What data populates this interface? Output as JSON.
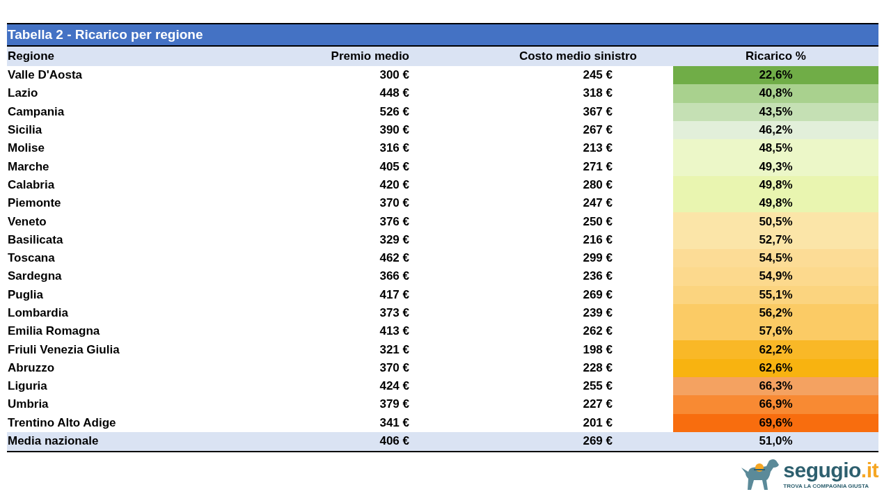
{
  "table": {
    "title": "Tabella 2 - Ricarico per regione",
    "columns": [
      "Regione",
      "Premio medio",
      "Costo medio sinistro",
      "Ricarico %"
    ],
    "rows": [
      {
        "region": "Valle D'Aosta",
        "premium": "300 €",
        "cost": "245 €",
        "markup": "22,6%",
        "color": "#70ad47"
      },
      {
        "region": "Lazio",
        "premium": "448 €",
        "cost": "318 €",
        "markup": "40,8%",
        "color": "#a9d18e"
      },
      {
        "region": "Campania",
        "premium": "526 €",
        "cost": "367 €",
        "markup": "43,5%",
        "color": "#c5e0b4"
      },
      {
        "region": "Sicilia",
        "premium": "390 €",
        "cost": "267 €",
        "markup": "46,2%",
        "color": "#e2efda"
      },
      {
        "region": "Molise",
        "premium": "316 €",
        "cost": "213 €",
        "markup": "48,5%",
        "color": "#ecf7c8"
      },
      {
        "region": "Marche",
        "premium": "405 €",
        "cost": "271 €",
        "markup": "49,3%",
        "color": "#ecf7c8"
      },
      {
        "region": "Calabria",
        "premium": "420 €",
        "cost": "280 €",
        "markup": "49,8%",
        "color": "#e9f5b0"
      },
      {
        "region": "Piemonte",
        "premium": "370 €",
        "cost": "247 €",
        "markup": "49,8%",
        "color": "#e9f5b0"
      },
      {
        "region": "Veneto",
        "premium": "376 €",
        "cost": "250 €",
        "markup": "50,5%",
        "color": "#fbe5a8"
      },
      {
        "region": "Basilicata",
        "premium": "329 €",
        "cost": "216 €",
        "markup": "52,7%",
        "color": "#fbe5a8"
      },
      {
        "region": "Toscana",
        "premium": "462 €",
        "cost": "299 €",
        "markup": "54,5%",
        "color": "#fcdc96"
      },
      {
        "region": "Sardegna",
        "premium": "366 €",
        "cost": "236 €",
        "markup": "54,9%",
        "color": "#fcd98d"
      },
      {
        "region": "Puglia",
        "premium": "417 €",
        "cost": "269 €",
        "markup": "55,1%",
        "color": "#fbd47f"
      },
      {
        "region": "Lombardia",
        "premium": "373 €",
        "cost": "239 €",
        "markup": "56,2%",
        "color": "#fbcb65"
      },
      {
        "region": "Emilia Romagna",
        "premium": "413 €",
        "cost": "262 €",
        "markup": "57,6%",
        "color": "#fbcb65"
      },
      {
        "region": "Friuli Venezia Giulia",
        "premium": "321 €",
        "cost": "198 €",
        "markup": "62,2%",
        "color": "#f9b827"
      },
      {
        "region": "Abruzzo",
        "premium": "370 €",
        "cost": "228 €",
        "markup": "62,6%",
        "color": "#f8b310"
      },
      {
        "region": "Liguria",
        "premium": "424 €",
        "cost": "255 €",
        "markup": "66,3%",
        "color": "#f4a261"
      },
      {
        "region": "Umbria",
        "premium": "379 €",
        "cost": "227 €",
        "markup": "66,9%",
        "color": "#f88a33"
      },
      {
        "region": "Trentino Alto Adige",
        "premium": "341 €",
        "cost": "201 €",
        "markup": "69,6%",
        "color": "#f86d0e"
      }
    ],
    "footer": {
      "region": "Media nazionale",
      "premium": "406 €",
      "cost": "269 €",
      "markup": "51,0%"
    }
  },
  "logo": {
    "name": "segugio",
    "suffix": ".it",
    "tagline": "TROVA LA COMPAGNIA GIUSTA"
  }
}
